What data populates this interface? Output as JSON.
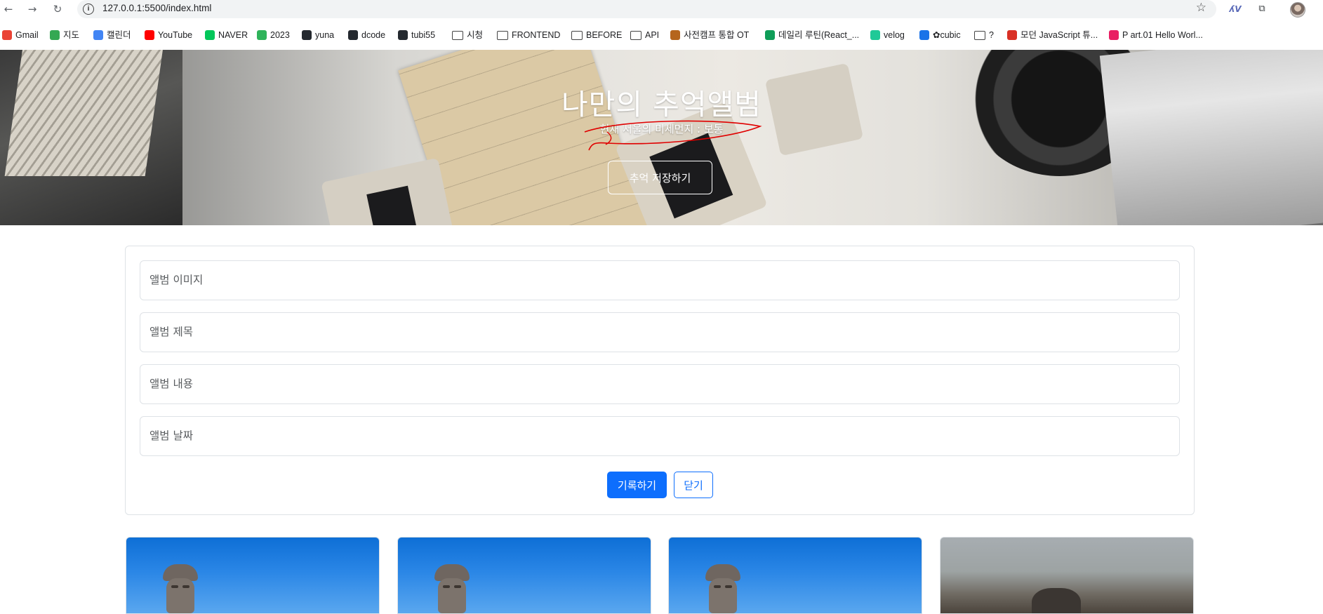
{
  "browser": {
    "url": "127.0.0.1:5500/index.html",
    "bookmarks": [
      {
        "label": "Gmail",
        "icon": "gmail-icon",
        "color": "#ea4335"
      },
      {
        "label": "지도",
        "icon": "maps-pin-icon",
        "color": "#34a853"
      },
      {
        "label": "캘린더",
        "icon": "calendar-icon",
        "color": "#4285f4"
      },
      {
        "label": "YouTube",
        "icon": "youtube-icon",
        "color": "#ff0000"
      },
      {
        "label": "NAVER",
        "icon": "naver-icon",
        "color": "#03c75a"
      },
      {
        "label": "2023",
        "icon": "leaf-icon",
        "color": "#2fb35a"
      },
      {
        "label": "yuna",
        "icon": "github-icon",
        "color": "#24292f"
      },
      {
        "label": "dcode",
        "icon": "github-icon",
        "color": "#24292f"
      },
      {
        "label": "tubi55",
        "icon": "github-icon",
        "color": "#24292f"
      },
      {
        "label": "시청",
        "icon": "folder-icon",
        "color": "#444444"
      },
      {
        "label": "FRONTEND",
        "icon": "folder-icon",
        "color": "#444444"
      },
      {
        "label": "BEFORE",
        "icon": "folder-icon",
        "color": "#444444"
      },
      {
        "label": "API",
        "icon": "folder-icon",
        "color": "#444444"
      },
      {
        "label": "사전캠프 통합 OT",
        "icon": "figure-icon",
        "color": "#b5651d"
      },
      {
        "label": "데일리 루틴(React_...",
        "icon": "sheets-icon",
        "color": "#0f9d58"
      },
      {
        "label": "velog",
        "icon": "velog-icon",
        "color": "#20c997"
      },
      {
        "label": "✿cubic",
        "icon": "chart-icon",
        "color": "#1a73e8"
      },
      {
        "label": "?",
        "icon": "folder-icon",
        "color": "#444444"
      },
      {
        "label": "모던 JavaScript 튜...",
        "icon": "person-icon",
        "color": "#d93025"
      },
      {
        "label": "P art.01 Hello Worl...",
        "icon": "target-icon",
        "color": "#e91e63"
      }
    ]
  },
  "hero": {
    "title": "나만의 추억앨범",
    "subtitle": "현재 서울의 미세먼지 : 보통",
    "button": "추억 저장하기"
  },
  "form": {
    "image_placeholder": "앨범 이미지",
    "title_placeholder": "앨범 제목",
    "content_placeholder": "앨범 내용",
    "date_placeholder": "앨범 날짜",
    "submit": "기록하기",
    "close": "닫기"
  },
  "colors": {
    "primary": "#0d6efd",
    "annotation": "#e00000"
  }
}
